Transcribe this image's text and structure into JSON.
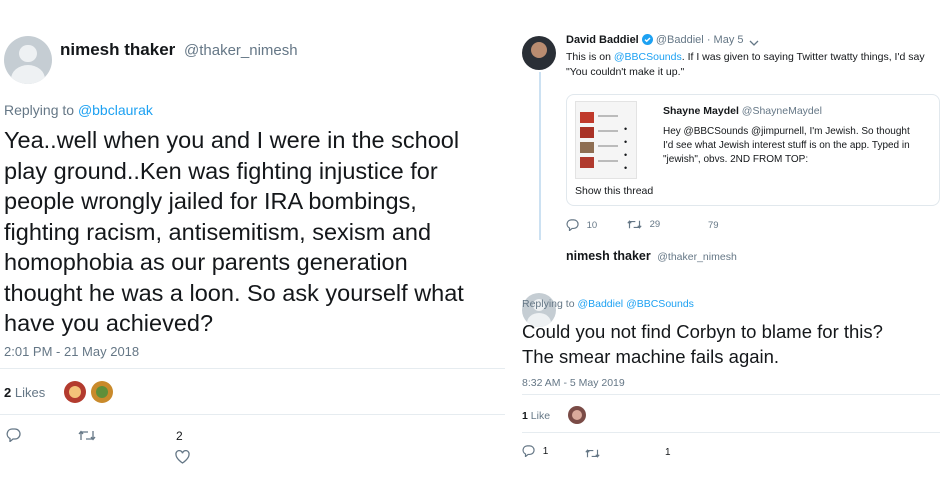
{
  "left": {
    "author_name": "nimesh thaker",
    "author_handle": "@thaker_nimesh",
    "replying_prefix": "Replying to",
    "replying_handle": "@bbclaurak",
    "lines": [
      "Yea..well when you and I were in the school",
      "play ground..Ken was fighting injustice for",
      "people wrongly jailed for IRA bombings,",
      "fighting racism, antisemitism, sexism and",
      "homophobia as our parents generation",
      "thought he was a loon. So ask yourself what",
      "have you achieved?"
    ],
    "timestamp": "2:01 PM - 21 May 2018",
    "likes_count": "2",
    "likes_label": "Likes",
    "like_action_count": "2"
  },
  "right": {
    "quoted": {
      "author_name": "David Baddiel",
      "author_handle": "@Baddiel",
      "date": "· May 5",
      "text_prefix": "This is on ",
      "text_mention": "@BBCSounds",
      "text_rest_1": ". If I was given to saying Twitter twatty things, I'd say",
      "text_line_2": "\"You couldn't make it up.\"",
      "card": {
        "author_name": "Shayne Maydel",
        "author_handle": "@ShayneMaydel",
        "lines": [
          "Hey @BBCSounds @jimpurnell, I'm Jewish. So thought",
          "I'd see what Jewish interest stuff is on the app. Typed in",
          "\"jewish\", obvs. 2ND FROM TOP:"
        ],
        "show_thread": "Show this thread"
      },
      "reply_count": "10",
      "retweet_count": "29",
      "like_count": "79"
    },
    "tweet": {
      "author_name": "nimesh thaker",
      "author_handle": "@thaker_nimesh",
      "replying_prefix": "Replying to",
      "replying_handle_1": "@Baddiel",
      "replying_handle_2": "@BBCSounds",
      "lines": [
        "Could you not find Corbyn to blame  for this?",
        "The smear machine fails again."
      ],
      "timestamp": "8:32 AM - 5 May 2019",
      "likes_count": "1",
      "likes_label": "Like",
      "reply_count": "1",
      "like_action_count": "1"
    }
  },
  "colors": {
    "link": "#1da1f2",
    "muted": "#657786",
    "divider": "#e6ecf0",
    "thread_line": "#cce1f2",
    "verified": "#1da1f2"
  },
  "icons": [
    "reply-icon",
    "retweet-icon",
    "like-icon",
    "dropdown-chevron-icon",
    "verified-badge-icon"
  ]
}
